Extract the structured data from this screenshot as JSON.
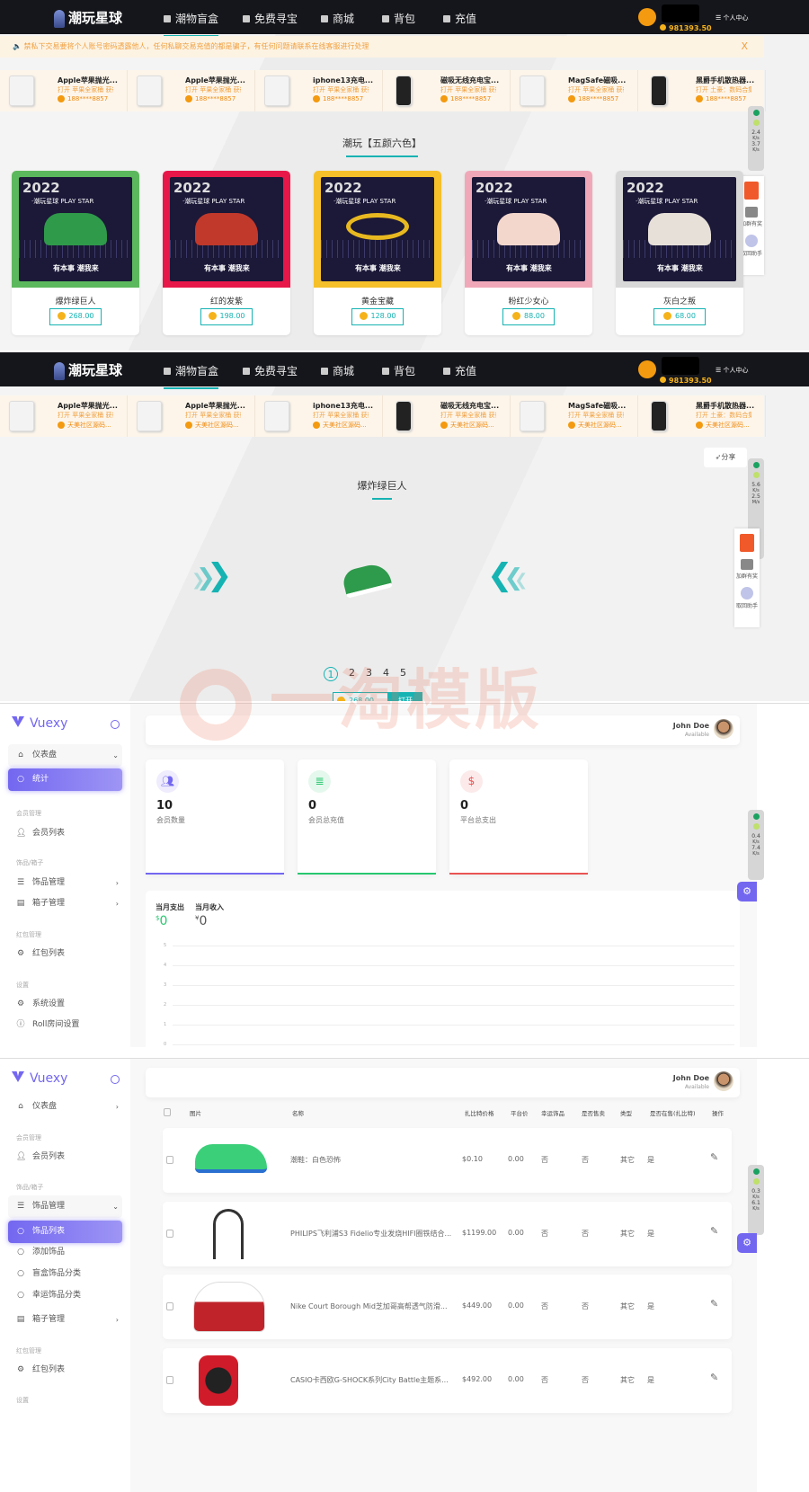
{
  "site": {
    "logo": "潮玩星球",
    "nav": [
      "潮物盲盒",
      "免费寻宝",
      "商城",
      "背包",
      "充值"
    ],
    "balance": "981393.50",
    "user_center": "个人中心",
    "notice": "禁私下交易要将个人账号密码透露他人，任何私聊交易充值的都是骗子，有任何问题请联系在线客服进行处理",
    "notice_close": "X",
    "ticker_names": [
      "Apple苹果抛光...",
      "Apple苹果抛光...",
      "iphone13充电...",
      "磁吸无线充电宝...",
      "MagSafe磁吸...",
      "黑爵手机散热器..."
    ],
    "ticker_opens": [
      "打开 苹果全家桶 获得",
      "打开 苹果全家桶 获得",
      "打开 苹果全家桶 获得",
      "打开 苹果全家桶 获得",
      "打开 苹果全家桶 获得",
      "打开 土豪：数码合集"
    ],
    "ticker_users_1": "188****8857",
    "ticker_users_2": "天美社区源码...",
    "side_widget": {
      "join": "加群有奖",
      "back": "取回助手"
    },
    "speed": [
      [
        "2.4",
        "K/s"
      ],
      [
        "3.7",
        "K/s"
      ],
      [
        "5.6",
        "K/s"
      ],
      [
        "2.5",
        "M/s"
      ],
      [
        "0.4",
        "K/s"
      ],
      [
        "7.4",
        "K/s"
      ],
      [
        "0.3",
        "K/s"
      ],
      [
        "6.1",
        "K/s"
      ]
    ]
  },
  "home": {
    "section_title": "潮玩【五颜六色】",
    "card_art": {
      "year": "2022",
      "brand": "·潮玩星球 PLAY STAR",
      "slogan": "有本事 潮我来"
    },
    "boxes": [
      {
        "name": "爆炸绿巨人",
        "price": "268.00",
        "color": "#5cb85c",
        "item": "#2f9a4a"
      },
      {
        "name": "红的发紫",
        "price": "198.00",
        "color": "#e8174a",
        "item": "#c0392b"
      },
      {
        "name": "黄金宝藏",
        "price": "128.00",
        "color": "#f5c02a",
        "item": "#e8b820"
      },
      {
        "name": "粉红少女心",
        "price": "88.00",
        "color": "#f0a8b8",
        "item": "#f3d6cc"
      },
      {
        "name": "灰白之叛",
        "price": "68.00",
        "color": "#d8d8d8",
        "item": "#e6e0d8"
      }
    ]
  },
  "detail": {
    "share": "分享",
    "title": "爆炸绿巨人",
    "pages": [
      "1",
      "2",
      "3",
      "4",
      "5"
    ],
    "price": "268.00",
    "open": "打开"
  },
  "watermark": "一淘模版",
  "admin": {
    "brand": "Vuexy",
    "user_name": "John Doe",
    "user_status": "Available",
    "dashboard": "仪表盘",
    "stats_item": "统计",
    "sections": {
      "members": "会员管理",
      "items": "饰品/箱子",
      "redpacket": "红包管理",
      "settings": "设置"
    },
    "member_list": "会员列表",
    "item_manage": "饰品管理",
    "box_manage": "箱子管理",
    "redpacket_list": "红包列表",
    "system_settings": "系统设置",
    "roll_settings": "Roll房间设置",
    "item_submenu": [
      "饰品列表",
      "添加饰品",
      "盲盒饰品分类",
      "幸运饰品分类"
    ],
    "stats": [
      {
        "value": "10",
        "label": "会员数量",
        "color": "#7367f0"
      },
      {
        "value": "0",
        "label": "会员总充值",
        "color": "#28c76f"
      },
      {
        "value": "0",
        "label": "平台总支出",
        "color": "#ea5455"
      }
    ],
    "chart": {
      "spend_label": "当月支出",
      "spend_value": "0",
      "spend_unit": "$",
      "income_label": "当月收入",
      "income_value": "0",
      "income_unit": "¥",
      "yticks": [
        "5",
        "4",
        "3",
        "2",
        "1",
        "0"
      ]
    },
    "table": {
      "headers": [
        "图片",
        "名称",
        "扎比特价格",
        "平台价",
        "幸运饰品",
        "是否售卖",
        "类型",
        "是否在售(扎比特)",
        "操作"
      ],
      "rows": [
        {
          "name": "潮鞋：白色恐怖",
          "price": "$0.10",
          "platform": "0.00",
          "lucky": "否",
          "sale": "否",
          "type": "其它",
          "onsale": "是",
          "img": "green-sneaker"
        },
        {
          "name": "PHILIPS飞利浦S3 Fidelio专业发烧HIFI圈铁结合...",
          "price": "$1199.00",
          "platform": "0.00",
          "lucky": "否",
          "sale": "否",
          "type": "其它",
          "onsale": "是",
          "img": "earphones"
        },
        {
          "name": "Nike Court Borough Mid芝加哥高帮透气防滑...",
          "price": "$449.00",
          "platform": "0.00",
          "lucky": "否",
          "sale": "否",
          "type": "其它",
          "onsale": "是",
          "img": "red-white-sneaker"
        },
        {
          "name": "CASIO卡西欧G-SHOCK系列City Battle主题系...",
          "price": "$492.00",
          "platform": "0.00",
          "lucky": "否",
          "sale": "否",
          "type": "其它",
          "onsale": "是",
          "img": "red-watch"
        }
      ]
    }
  }
}
